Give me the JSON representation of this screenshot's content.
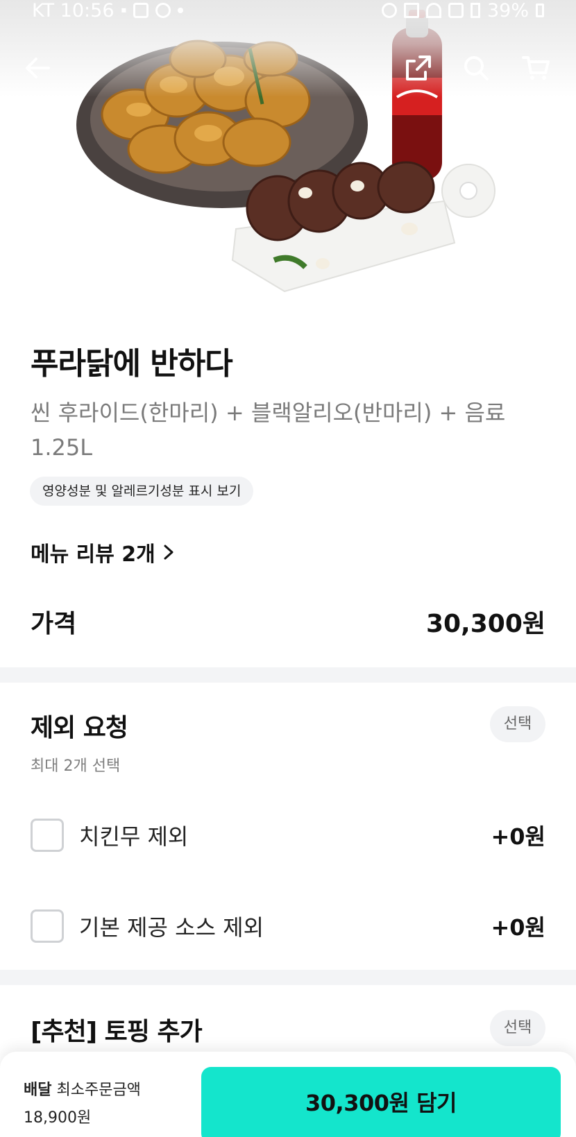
{
  "status_bar": {
    "carrier_time": "KT 10:56",
    "battery": "39%",
    "notification_icons": [
      "alarm-icon",
      "mute-icon",
      "wifi-icon",
      "hd-icon",
      "signal-icon"
    ]
  },
  "top_nav": {
    "back_icon": "arrow-left-icon",
    "share_icon": "share-icon",
    "search_icon": "search-icon",
    "cart_icon": "cart-icon"
  },
  "product": {
    "image": "chicken-set-photo",
    "title": "푸라닭에 반하다",
    "description": "씬 후라이드(한마리) + 블랙알리오(반마리) + 음료 1.25L",
    "nutrition_chip": "영양성분 및 알레르기성분 표시 보기",
    "reviews_label": "메뉴 리뷰 2개",
    "price_label": "가격",
    "price_value": "30,300원"
  },
  "sections": [
    {
      "title": "제외 요청",
      "subtitle": "최대 2개 선택",
      "badge": "선택",
      "options": [
        {
          "label": "치킨무 제외",
          "price": "+0원",
          "checked": false
        },
        {
          "label": "기본 제공 소스 제외",
          "price": "+0원",
          "checked": false
        }
      ]
    },
    {
      "title": "[추천] 토핑 추가",
      "badge": "선택"
    }
  ],
  "bottom_bar": {
    "delivery_label": "배달",
    "min_order_label": "최소주문금액",
    "min_order_value": "18,900원",
    "add_button_label": "30,300원 담기"
  },
  "colors": {
    "accent": "#14e5cc",
    "divider": "#f3f4f6",
    "chip_bg": "#f2f3f5",
    "muted_text": "#7a7a7a"
  }
}
